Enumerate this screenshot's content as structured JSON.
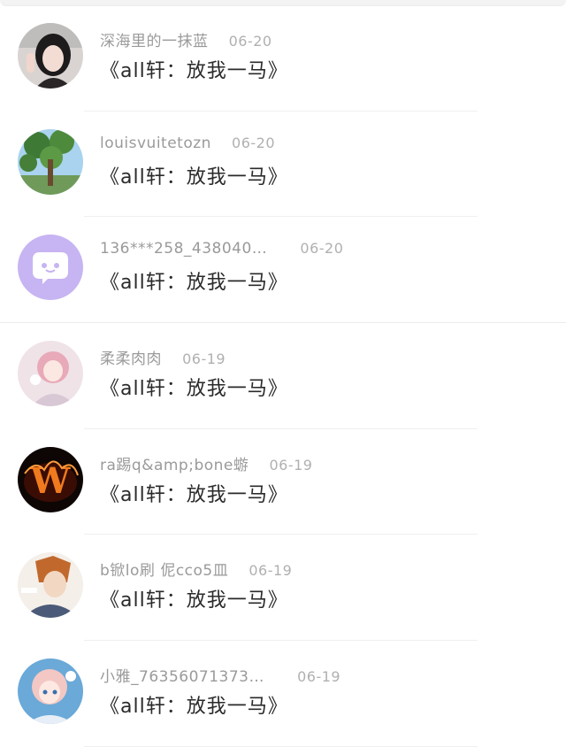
{
  "items": [
    {
      "username": "深海里的一抹蓝",
      "date": "06-20",
      "title": "《all轩：放我一马》",
      "avatar_icon": "avatar-girl-photo"
    },
    {
      "username": "louisvuitetozn",
      "date": "06-20",
      "title": "《all轩：放我一马》",
      "avatar_icon": "avatar-tree"
    },
    {
      "username": "136***258_438040…",
      "date": "06-20",
      "title": "《all轩：放我一马》",
      "avatar_icon": "avatar-default-chat"
    },
    {
      "username": "柔柔肉肉",
      "date": "06-19",
      "title": "《all轩：放我一马》",
      "avatar_icon": "avatar-anime-girl"
    },
    {
      "username": "ra踢q&amp;bone蝣",
      "date": "06-19",
      "title": "《all轩：放我一马》",
      "avatar_icon": "avatar-fire-w"
    },
    {
      "username": "b锨lo刷 伲cco5皿",
      "date": "06-19",
      "title": "《all轩：放我一马》",
      "avatar_icon": "avatar-anime-boy"
    },
    {
      "username": "小雅_76356071373…",
      "date": "06-19",
      "title": "《all轩：放我一马》",
      "avatar_icon": "avatar-anime-blue"
    }
  ],
  "colors": {
    "username": "#9a9a9a",
    "date": "#b0b0b0",
    "title": "#2a2a2a",
    "default_avatar": "#c7b4f2"
  }
}
